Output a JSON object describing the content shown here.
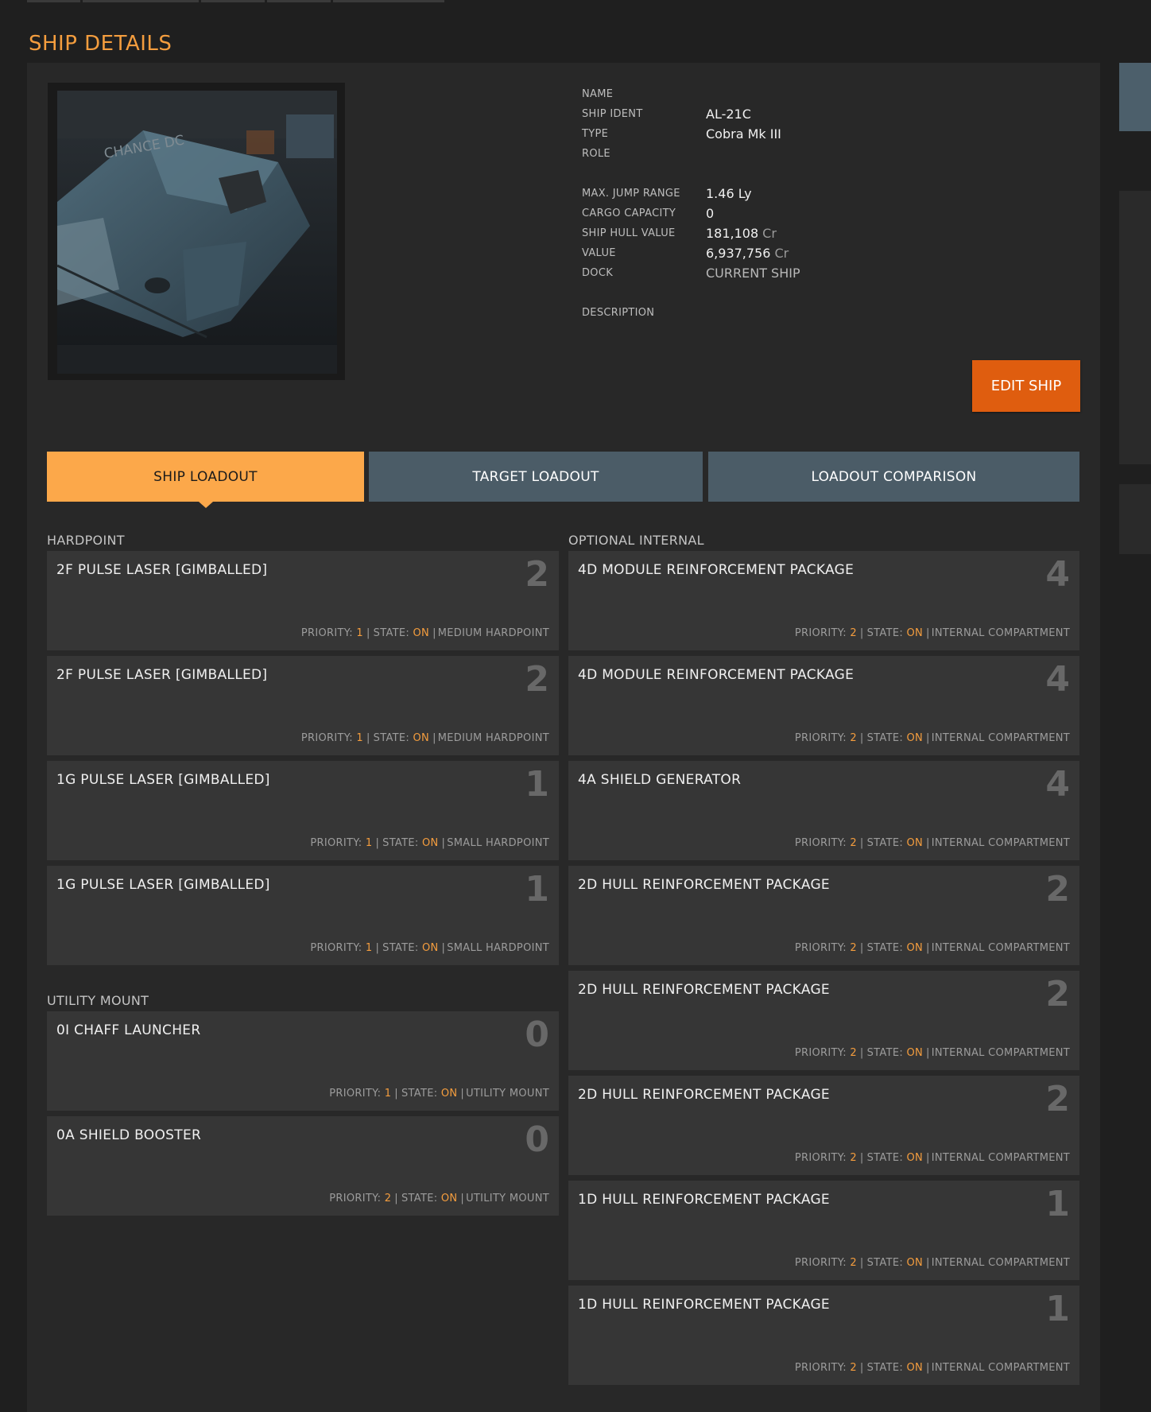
{
  "page": {
    "title": "SHIP DETAILS"
  },
  "ship": {
    "fields": [
      {
        "label": "NAME",
        "value": ""
      },
      {
        "label": "SHIP IDENT",
        "value": "AL-21C"
      },
      {
        "label": "TYPE",
        "value": "Cobra Mk III"
      },
      {
        "label": "ROLE",
        "value": ""
      },
      {
        "label": "MAX. JUMP RANGE",
        "value": "1.46 Ly"
      },
      {
        "label": "CARGO CAPACITY",
        "value": "0"
      },
      {
        "label": "SHIP HULL VALUE",
        "value": "181,108",
        "unit": "Cr"
      },
      {
        "label": "VALUE",
        "value": "6,937,756",
        "unit": "Cr"
      },
      {
        "label": "DOCK",
        "value": "CURRENT SHIP"
      },
      {
        "label": "DESCRIPTION",
        "value": ""
      }
    ],
    "image_text": "CHANCE DC",
    "edit_label": "EDIT SHIP"
  },
  "tabs": {
    "ship_loadout": "SHIP LOADOUT",
    "target_loadout": "TARGET LOADOUT",
    "loadout_comparison": "LOADOUT COMPARISON"
  },
  "labels": {
    "priority": "PRIORITY:",
    "state": "STATE:"
  },
  "hardpoint": {
    "title": "HARDPOINT",
    "modules": [
      {
        "name": "2F PULSE LASER [GIMBALLED]",
        "size": "2",
        "priority": "1",
        "state": "ON",
        "slot": "MEDIUM HARDPOINT"
      },
      {
        "name": "2F PULSE LASER [GIMBALLED]",
        "size": "2",
        "priority": "1",
        "state": "ON",
        "slot": "MEDIUM HARDPOINT"
      },
      {
        "name": "1G PULSE LASER [GIMBALLED]",
        "size": "1",
        "priority": "1",
        "state": "ON",
        "slot": "SMALL HARDPOINT"
      },
      {
        "name": "1G PULSE LASER [GIMBALLED]",
        "size": "1",
        "priority": "1",
        "state": "ON",
        "slot": "SMALL HARDPOINT"
      }
    ]
  },
  "utility": {
    "title": "UTILITY MOUNT",
    "modules": [
      {
        "name": "0I CHAFF LAUNCHER",
        "size": "0",
        "priority": "1",
        "state": "ON",
        "slot": "UTILITY MOUNT"
      },
      {
        "name": "0A SHIELD BOOSTER",
        "size": "0",
        "priority": "2",
        "state": "ON",
        "slot": "UTILITY MOUNT"
      }
    ]
  },
  "optional": {
    "title": "OPTIONAL INTERNAL",
    "modules": [
      {
        "name": "4D MODULE REINFORCEMENT PACKAGE",
        "size": "4",
        "priority": "2",
        "state": "ON",
        "slot": "INTERNAL COMPARTMENT"
      },
      {
        "name": "4D MODULE REINFORCEMENT PACKAGE",
        "size": "4",
        "priority": "2",
        "state": "ON",
        "slot": "INTERNAL COMPARTMENT"
      },
      {
        "name": "4A SHIELD GENERATOR",
        "size": "4",
        "priority": "2",
        "state": "ON",
        "slot": "INTERNAL COMPARTMENT"
      },
      {
        "name": "2D HULL REINFORCEMENT PACKAGE",
        "size": "2",
        "priority": "2",
        "state": "ON",
        "slot": "INTERNAL COMPARTMENT"
      },
      {
        "name": "2D HULL REINFORCEMENT PACKAGE",
        "size": "2",
        "priority": "2",
        "state": "ON",
        "slot": "INTERNAL COMPARTMENT"
      },
      {
        "name": "2D HULL REINFORCEMENT PACKAGE",
        "size": "2",
        "priority": "2",
        "state": "ON",
        "slot": "INTERNAL COMPARTMENT"
      },
      {
        "name": "1D HULL REINFORCEMENT PACKAGE",
        "size": "1",
        "priority": "2",
        "state": "ON",
        "slot": "INTERNAL COMPARTMENT"
      },
      {
        "name": "1D HULL REINFORCEMENT PACKAGE",
        "size": "1",
        "priority": "2",
        "state": "ON",
        "slot": "INTERNAL COMPARTMENT"
      }
    ]
  }
}
